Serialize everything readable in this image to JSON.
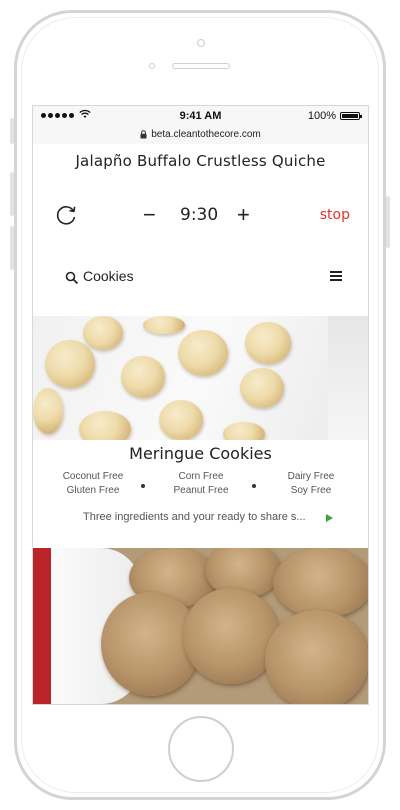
{
  "status_bar": {
    "carrier_icon": "signal-dots",
    "wifi_icon": "wifi-icon",
    "time": "9:41 AM",
    "battery_percent": "100%",
    "battery_level": 1.0
  },
  "browser": {
    "url": "beta.cleantothecore.com",
    "lock_icon": "lock-icon"
  },
  "recipe": {
    "title": "Jalapño Buffalo Crustless Quiche"
  },
  "timer": {
    "reset_icon": "refresh-icon",
    "minus_label": "−",
    "time": "9:30",
    "plus_label": "+",
    "stop_label": "stop",
    "stop_color": "#e0312d"
  },
  "search": {
    "icon": "search-icon",
    "label": "Cookies",
    "menu_icon": "hamburger-menu-icon"
  },
  "cards": [
    {
      "title": "Meringue Cookies",
      "tags": [
        [
          "Coconut Free",
          "Gluten Free"
        ],
        [
          "Corn Free",
          "Peanut Free"
        ],
        [
          "Dairy Free",
          "Soy Free"
        ]
      ],
      "description": "Three ingredients and your ready to share s...",
      "play_icon": "play-icon",
      "play_color": "#3aa43a"
    }
  ],
  "colors": {
    "accent_stop": "#e0312d",
    "accent_play": "#3aa43a",
    "text": "#222222"
  }
}
